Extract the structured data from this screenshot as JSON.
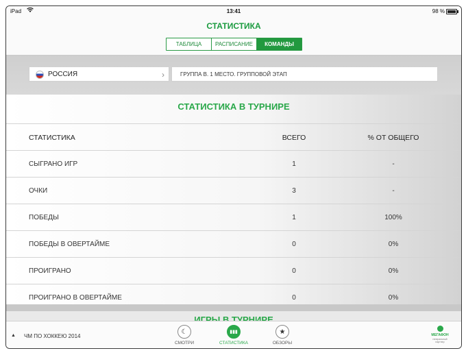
{
  "status_bar": {
    "device": "iPad",
    "time": "13:41",
    "battery": "98 %",
    "battery_level": 0.98
  },
  "nav": {
    "title": "СТАТИСТИКА"
  },
  "segments": [
    {
      "label": "ТАБЛИЦА",
      "active": false
    },
    {
      "label": "РАСПИСАНИЕ",
      "active": false
    },
    {
      "label": "КОМАНДЫ",
      "active": true
    }
  ],
  "filter": {
    "country": "РОССИЯ",
    "group": "ГРУППА В. 1 МЕСТО. ГРУППОВОЙ ЭТАП"
  },
  "stats": {
    "title": "СТАТИСТИКА В ТУРНИРЕ",
    "headers": {
      "name": "СТАТИСТИКА",
      "total": "ВСЕГО",
      "percent": "% ОТ ОБЩЕГО"
    },
    "rows": [
      {
        "name": "СЫГРАНО ИГР",
        "total": "1",
        "percent": "-"
      },
      {
        "name": "ОЧКИ",
        "total": "3",
        "percent": "-"
      },
      {
        "name": "ПОБЕДЫ",
        "total": "1",
        "percent": "100%"
      },
      {
        "name": "ПОБЕДЫ В ОВЕРТАЙМЕ",
        "total": "0",
        "percent": "0%"
      },
      {
        "name": "ПРОИГРАНО",
        "total": "0",
        "percent": "0%"
      },
      {
        "name": "ПРОИГРАНО В ОВЕРТАЙМЕ",
        "total": "0",
        "percent": "0%"
      }
    ]
  },
  "games": {
    "title": "ИГРЫ В ТУРНИРЕ"
  },
  "tabbar": {
    "section": "ЧМ ПО ХОККЕЮ 2014",
    "tabs": [
      {
        "label": "СМОТРИ",
        "icon": "moon-icon"
      },
      {
        "label": "СТАТИСТИКА",
        "icon": "stats-icon",
        "active": true
      },
      {
        "label": "ОБЗОРЫ",
        "icon": "star-icon"
      }
    ],
    "brand": {
      "name": "МЕГАФОН",
      "sub": "генеральный партнер"
    }
  }
}
